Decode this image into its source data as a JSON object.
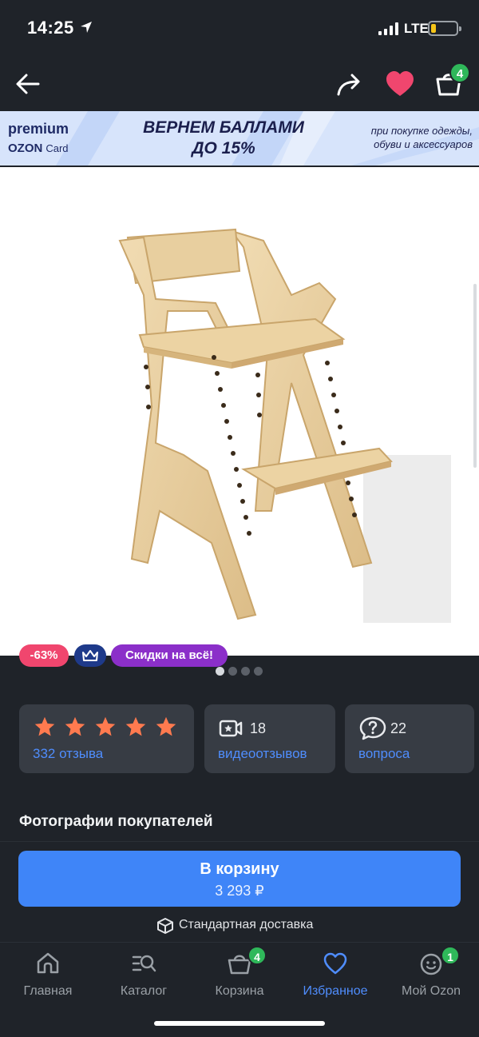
{
  "status_bar": {
    "time": "14:25",
    "network": "LTE"
  },
  "top_bar": {
    "cart_count": "4"
  },
  "banner": {
    "brand_line1": "premium",
    "brand_line2": "OZON",
    "brand_line2_suffix": "Card",
    "headline_line1": "ВЕРНЕМ БАЛЛАМИ",
    "headline_line2": "ДО 15%",
    "sub_line1": "при покупке одежды,",
    "sub_line2": "обуви и аксессуаров"
  },
  "chips": {
    "discount": "-63%",
    "sale": "Скидки на всё!"
  },
  "gallery": {
    "total": 4,
    "active": 1
  },
  "rating": {
    "stars": 5,
    "reviews_link": "332 отзыва"
  },
  "videos": {
    "count": "18",
    "link": "видеоотзывов"
  },
  "questions": {
    "count": "22",
    "link": "вопроса"
  },
  "section": {
    "customer_photos": "Фотографии покупателей"
  },
  "cta": {
    "label": "В корзину",
    "price": "3 293 ₽"
  },
  "delivery": {
    "label": "Стандартная доставка"
  },
  "nav": {
    "items": [
      {
        "label": "Главная",
        "icon": "home-icon"
      },
      {
        "label": "Каталог",
        "icon": "catalog-icon"
      },
      {
        "label": "Корзина",
        "icon": "basket-icon",
        "badge": "4"
      },
      {
        "label": "Избранное",
        "icon": "heart-icon",
        "active": true
      },
      {
        "label": "Мой Ozon",
        "icon": "profile-icon",
        "badge": "1"
      }
    ]
  },
  "colors": {
    "background": "#1f2329",
    "card": "#373c44",
    "accent_blue": "#3f85f8",
    "link_blue": "#4f8dfd",
    "heart_red": "#f0466e",
    "badge_green": "#2fb85a",
    "star": "#ff7a4f"
  }
}
